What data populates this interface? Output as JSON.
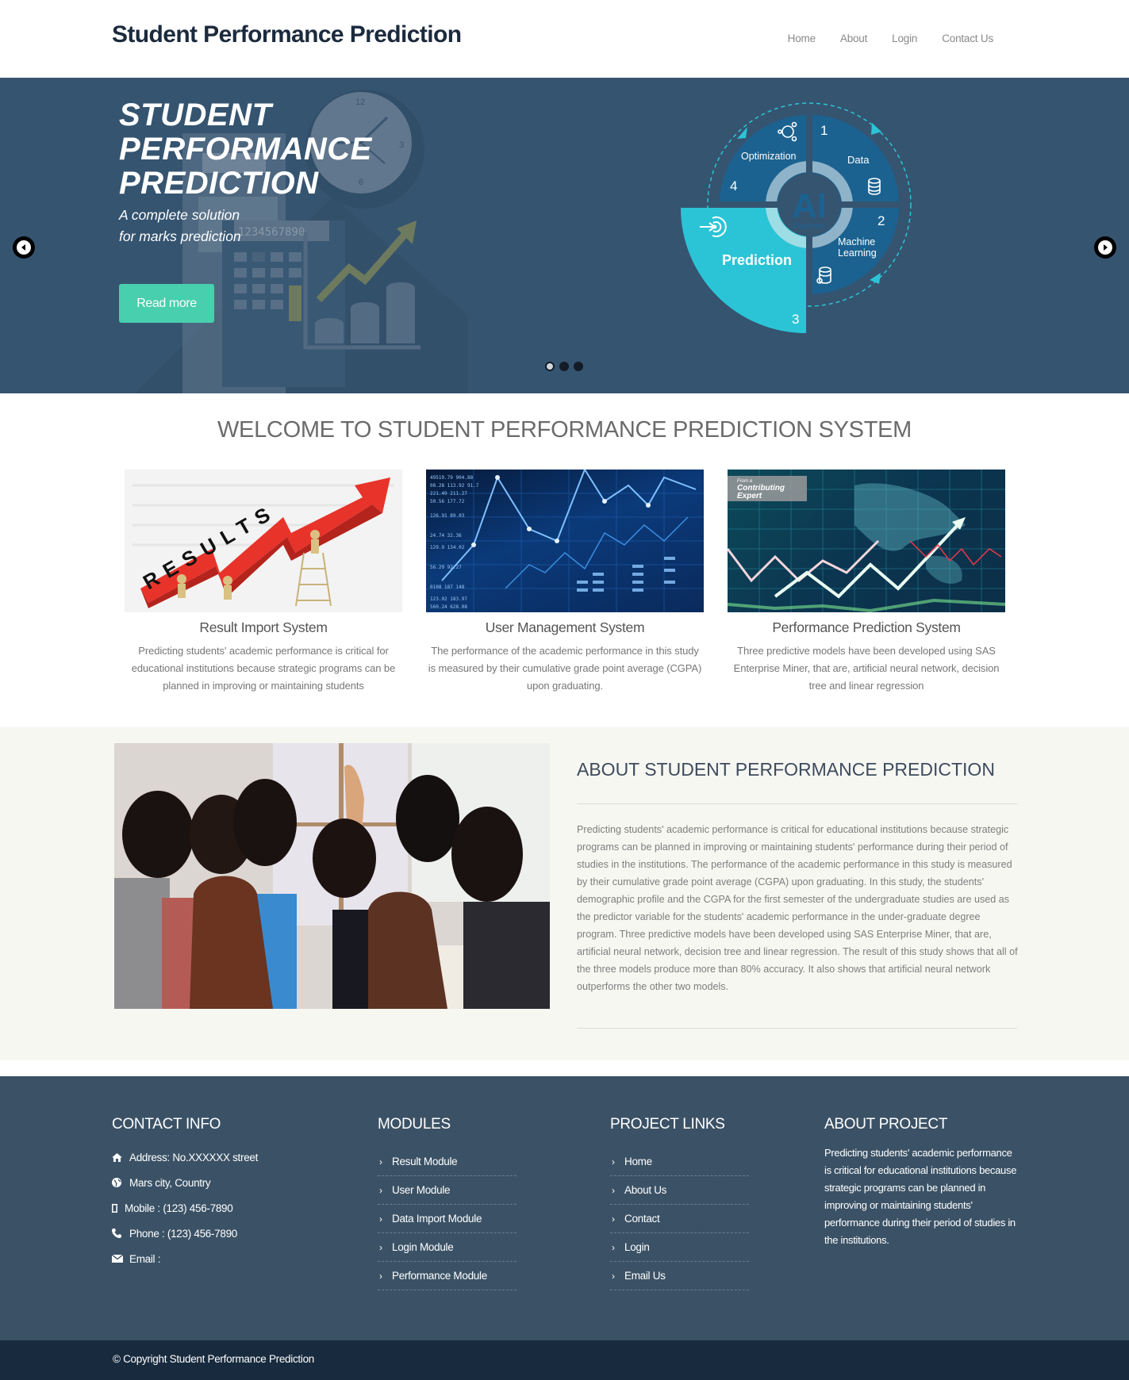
{
  "header": {
    "brand": "Student Performance Prediction",
    "nav": [
      {
        "label": "Home"
      },
      {
        "label": "About"
      },
      {
        "label": "Login"
      },
      {
        "label": "Contact Us"
      }
    ]
  },
  "hero": {
    "title_lines": [
      "STUDENT",
      "PERFORMANCE",
      "PREDICTION"
    ],
    "subtitle_lines": [
      "A complete solution",
      "for marks prediction"
    ],
    "button_label": "Read more",
    "slide_count": 3,
    "active_slide": 1,
    "diagram": {
      "center_text": "AI",
      "center_subtext": "Powered",
      "segments": [
        {
          "number": "1",
          "label": "Data"
        },
        {
          "number": "2",
          "label": "Machine Learning"
        },
        {
          "number": "3",
          "label": "Prediction"
        },
        {
          "number": "4",
          "label": "Optimization"
        }
      ]
    },
    "illustration_digits": "1234567890",
    "clock_numbers": [
      "12",
      "3",
      "6"
    ]
  },
  "welcome": {
    "title": "WELCOME TO STUDENT PERFORMANCE PREDICTION SYSTEM",
    "cards": [
      {
        "title": "Result Import System",
        "text": "Predicting students' academic performance is critical for educational institutions because strategic programs can be planned in improving or maintaining students",
        "image_text": "RESULTS"
      },
      {
        "title": "User Management System",
        "text": "The performance of the academic performance in this study is measured by their cumulative grade point average (CGPA) upon graduating."
      },
      {
        "title": "Performance Prediction System",
        "text": "Three predictive models have been developed using SAS Enterprise Miner, that are, artificial neural network, decision tree and linear regression",
        "image_badge": [
          "From a",
          "Contributing",
          "Expert"
        ]
      }
    ]
  },
  "about": {
    "title": "ABOUT STUDENT PERFORMANCE PREDICTION",
    "text": "Predicting students' academic performance is critical for educational institutions because strategic programs can be planned in improving or maintaining students' performance during their period of studies in the institutions. The performance of the academic performance in this study is measured by their cumulative grade point average (CGPA) upon graduating. In this study, the students' demographic profile and the CGPA for the first semester of the undergraduate studies are used as the predictor variable for the students' academic performance in the under-graduate degree program. Three predictive models have been developed using SAS Enterprise Miner, that are, artificial neural network, decision tree and linear regression. The result of this study shows that all of the three models produce more than 80% accuracy. It also shows that artificial neural network outperforms the other two models."
  },
  "footer": {
    "contact": {
      "title": "CONTACT INFO",
      "items": [
        {
          "icon": "home-icon",
          "text": "Address: No.XXXXXX street"
        },
        {
          "icon": "globe-icon",
          "text": "Mars city, Country"
        },
        {
          "icon": "mobile-icon",
          "text": "Mobile : (123) 456-7890"
        },
        {
          "icon": "phone-icon",
          "text": "Phone : (123) 456-7890"
        },
        {
          "icon": "envelope-icon",
          "text": "Email :"
        }
      ]
    },
    "modules": {
      "title": "MODULES",
      "items": [
        "Result Module",
        "User Module",
        "Data Import Module",
        "Login Module",
        "Performance Module"
      ]
    },
    "links": {
      "title": "PROJECT LINKS",
      "items": [
        "Home",
        "About Us",
        "Contact",
        "Login",
        "Email Us"
      ]
    },
    "about": {
      "title": "ABOUT PROJECT",
      "text": "Predicting students' academic performance is critical for educational institutions because strategic programs can be planned in improving or maintaining students' performance during their period of studies in the institutions."
    },
    "copyright": "© Copyright Student Performance Prediction"
  },
  "colors": {
    "hero_bg": "#355470",
    "accent": "#48cfad",
    "footer_bg": "#3b5266",
    "bottom_bar_bg": "#172a3e",
    "about_bg": "#f7f7f2",
    "diagram_cyan": "#2bc4d6",
    "diagram_blue": "#1b6290"
  }
}
